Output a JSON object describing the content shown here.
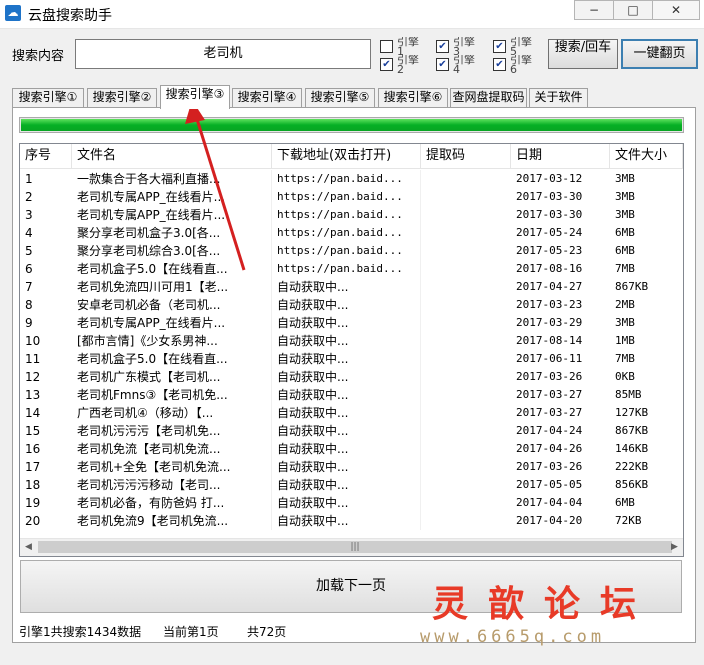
{
  "window": {
    "title": "云盘搜索助手",
    "minimize": "−",
    "maximize": "□",
    "close": "✕"
  },
  "search": {
    "label": "搜索内容",
    "value": "老司机"
  },
  "engines": [
    {
      "label": "引擎1",
      "checked": false
    },
    {
      "label": "引擎2",
      "checked": true
    },
    {
      "label": "引擎3",
      "checked": true
    },
    {
      "label": "引擎4",
      "checked": true
    },
    {
      "label": "引擎5",
      "checked": true
    },
    {
      "label": "引擎6",
      "checked": true
    }
  ],
  "buttons": {
    "search": "搜索/回车",
    "flip_all": "一键翻页",
    "load_next": "加载下一页"
  },
  "tabs": [
    "搜索引擎①",
    "搜索引擎②",
    "搜索引擎③",
    "搜索引擎④",
    "搜索引擎⑤",
    "搜索引擎⑥",
    "查网盘提取码",
    "关于软件"
  ],
  "active_tab": 2,
  "progress": 1.0,
  "table": {
    "columns": [
      "序号",
      "文件名",
      "下载地址(双击打开)",
      "提取码",
      "日期",
      "文件大小"
    ],
    "rows": [
      [
        "1",
        "一款集合于各大福利直播...",
        "https://pan.baid...",
        "",
        "2017-03-12",
        "3MB"
      ],
      [
        "2",
        "老司机专属APP_在线看片...",
        "https://pan.baid...",
        "",
        "2017-03-30",
        "3MB"
      ],
      [
        "3",
        "老司机专属APP_在线看片...",
        "https://pan.baid...",
        "",
        "2017-03-30",
        "3MB"
      ],
      [
        "4",
        "聚分享老司机盒子3.0[各...",
        "https://pan.baid...",
        "",
        "2017-05-24",
        "6MB"
      ],
      [
        "5",
        "聚分享老司机综合3.0[各...",
        "https://pan.baid...",
        "",
        "2017-05-23",
        "6MB"
      ],
      [
        "6",
        "老司机盒子5.0【在线看直...",
        "https://pan.baid...",
        "",
        "2017-08-16",
        "7MB"
      ],
      [
        "7",
        "老司机免流四川可用1【老...",
        "自动获取中...",
        "",
        "2017-04-27",
        "867KB"
      ],
      [
        "8",
        "安卓老司机必备（老司机...",
        "自动获取中...",
        "",
        "2017-03-23",
        "2MB"
      ],
      [
        "9",
        "老司机专属APP_在线看片...",
        "自动获取中...",
        "",
        "2017-03-29",
        "3MB"
      ],
      [
        "10",
        "[都市言情]《少女系男神...",
        "自动获取中...",
        "",
        "2017-08-14",
        "1MB"
      ],
      [
        "11",
        "老司机盒子5.0【在线看直...",
        "自动获取中...",
        "",
        "2017-06-11",
        "7MB"
      ],
      [
        "12",
        "老司机广东模式【老司机...",
        "自动获取中...",
        "",
        "2017-03-26",
        "0KB"
      ],
      [
        "13",
        "老司机Fmns③【老司机免...",
        "自动获取中...",
        "",
        "2017-03-27",
        "85MB"
      ],
      [
        "14",
        "广西老司机④（移动）【...",
        "自动获取中...",
        "",
        "2017-03-27",
        "127KB"
      ],
      [
        "15",
        "老司机污污污【老司机免...",
        "自动获取中...",
        "",
        "2017-04-24",
        "867KB"
      ],
      [
        "16",
        "老司机免流【老司机免流...",
        "自动获取中...",
        "",
        "2017-04-26",
        "146KB"
      ],
      [
        "17",
        "老司机+全免【老司机免流...",
        "自动获取中...",
        "",
        "2017-03-26",
        "222KB"
      ],
      [
        "18",
        "老司机污污污移动【老司...",
        "自动获取中...",
        "",
        "2017-05-05",
        "856KB"
      ],
      [
        "19",
        "老司机必备，有防爸妈 打...",
        "自动获取中...",
        "",
        "2017-04-04",
        "6MB"
      ],
      [
        "20",
        "老司机免流9【老司机免流...",
        "自动获取中...",
        "",
        "2017-04-20",
        "72KB"
      ]
    ],
    "scroll_left": "◀",
    "scroll_right": "▶",
    "scroll_grip": "|||"
  },
  "status": {
    "engine_total": "引擎1共搜索1434数据",
    "current_page": "当前第1页",
    "total_pages": "共72页"
  },
  "watermark": {
    "cn": "灵歆论坛",
    "url": "www.6665q.com"
  },
  "colors": {
    "progress_green": "#06b025",
    "arrow_red": "#d42020",
    "watermark_red": "#e83a27"
  }
}
